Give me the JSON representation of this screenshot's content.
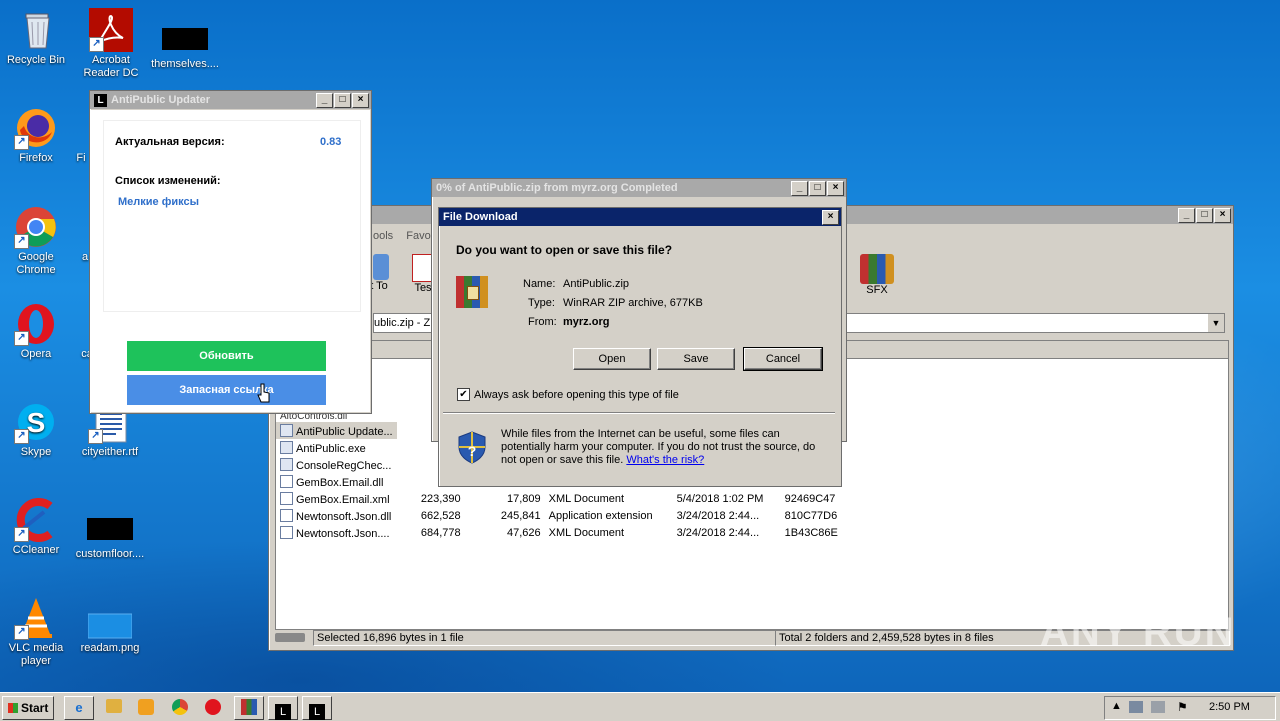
{
  "desktop": {
    "icons": [
      {
        "label": "Recycle Bin",
        "icon": "recycle-bin-icon"
      },
      {
        "label": "Acrobat\nReader DC",
        "icon": "acrobat-icon"
      },
      {
        "label": "themselves....",
        "icon": "black-file-icon"
      },
      {
        "label": "Firefox",
        "icon": "firefox-icon"
      },
      {
        "label": "Fi",
        "icon": "partial-icon"
      },
      {
        "label": "Google\nChrome",
        "icon": "chrome-icon"
      },
      {
        "label": "a",
        "icon": "partial-icon"
      },
      {
        "label": "Opera",
        "icon": "opera-icon"
      },
      {
        "label": "ca",
        "icon": "partial-icon"
      },
      {
        "label": "Skype",
        "icon": "skype-icon"
      },
      {
        "label": "cityeither.rtf",
        "icon": "rtf-file-icon"
      },
      {
        "label": "CCleaner",
        "icon": "ccleaner-icon"
      },
      {
        "label": "customfloor....",
        "icon": "black-file-icon"
      },
      {
        "label": "VLC media\nplayer",
        "icon": "vlc-icon"
      },
      {
        "label": "readam.png",
        "icon": "png-file-icon"
      }
    ]
  },
  "updater": {
    "title": "AntiPublic Updater",
    "version_label": "Актуальная версия:",
    "version_value": "0.83",
    "changes_label": "Список изменений:",
    "changes_value": "Мелкие фиксы",
    "update_button": "Обновить",
    "backup_button": "Запасная ссылка",
    "colors": {
      "update": "#1ec25b",
      "backup": "#4a8ee6",
      "link": "#2f6fca"
    }
  },
  "progress_window": {
    "title": "0% of AntiPublic.zip from myrz.org Completed"
  },
  "winrar": {
    "menu_partial": [
      "ools",
      "Favo"
    ],
    "toolbar_partial": [
      "t To",
      "Tes"
    ],
    "sfx_label": "SFX",
    "address_partial": "ublic.zip - ZI",
    "files": [
      {
        "name": "AltoControls.dll",
        "size": "",
        "packed": "",
        "type": "",
        "modified": "",
        "crc": ""
      },
      {
        "name": "AntiPublic Update...",
        "size": "",
        "packed": "",
        "type": "",
        "modified": "",
        "crc": ""
      },
      {
        "name": "AntiPublic.exe",
        "size": "29",
        "packed": "",
        "type": "",
        "modified": "",
        "crc": ""
      },
      {
        "name": "ConsoleRegChec...",
        "size": "",
        "packed": "",
        "type": "",
        "modified": "",
        "crc": ""
      },
      {
        "name": "GemBox.Email.dll",
        "size": "54",
        "packed": "",
        "type": "",
        "modified": "",
        "crc": ""
      },
      {
        "name": "GemBox.Email.xml",
        "size": "223,390",
        "packed": "17,809",
        "type": "XML Document",
        "modified": "5/4/2018 1:02 PM",
        "crc": "92469C47"
      },
      {
        "name": "Newtonsoft.Json.dll",
        "size": "662,528",
        "packed": "245,841",
        "type": "Application extension",
        "modified": "3/24/2018 2:44...",
        "crc": "810C77D6"
      },
      {
        "name": "Newtonsoft.Json....",
        "size": "684,778",
        "packed": "47,626",
        "type": "XML Document",
        "modified": "3/24/2018 2:44...",
        "crc": "1B43C86E"
      }
    ],
    "status_left": "Selected 16,896 bytes in 1 file",
    "status_right": "Total 2 folders and 2,459,528 bytes in 8 files"
  },
  "file_download": {
    "title": "File Download",
    "question": "Do you want to open or save this file?",
    "name_label": "Name:",
    "name_value": "AntiPublic.zip",
    "type_label": "Type:",
    "type_value": "WinRAR ZIP archive, 677KB",
    "from_label": "From:",
    "from_value": "myrz.org",
    "open_button": "Open",
    "save_button": "Save",
    "cancel_button": "Cancel",
    "checkbox_label": "Always ask before opening this type of file",
    "checkbox_checked": true,
    "warning_text": "While files from the Internet can be useful, some files can potentially harm your computer. If you do not trust the source, do not open or save this file.",
    "risk_link": "What's the risk?"
  },
  "taskbar": {
    "start_label": "Start",
    "clock": "2:50 PM",
    "watermark": "ANY RUN"
  }
}
